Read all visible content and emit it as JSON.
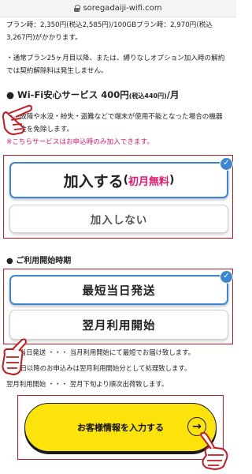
{
  "browser": {
    "url": "soregadaiji-wifi.com"
  },
  "top_text": {
    "price_line": "プラン時：2,350円(税込2,585円)/100GBプラン時：2,970円(税込3,267円)がかかります。",
    "note_line": "・通常プラン25ヶ月目以降、または、縛りなしオプション加入時の解約では契約解除料は発生しません。"
  },
  "wifi_section": {
    "heading_prefix": "●",
    "heading_main": " Wi-Fi安心サービス 400円",
    "heading_small": "(税込440円)",
    "heading_suffix": "/月",
    "desc_line1": "自然故障や水没・紛失・盗難などで端末が使用不能となった場合の機器",
    "desc_line2": "損害金を免除します。",
    "desc_pink": "※こちらサービスはお申込時のみ加入できます。",
    "option_join_main": "加入する",
    "option_join_open": "(",
    "option_join_pink": "初月無料",
    "option_join_close": ")",
    "option_nojoin": "加入しない",
    "check_glyph": "✓"
  },
  "start_section": {
    "heading": "● ご利用開始時期",
    "option_fast": "最短当日発送",
    "option_nextmonth": "翌月利用開始",
    "check_glyph": "✓",
    "line1": "最短当日発送 ・・・ 当月利用開始にて最短でお届け致します。",
    "line2": "※26日以降のお申込みは翌月利用開始分として処理致します。",
    "line3": "翌月利用開始 ・・・ 翌月下旬より順次出荷致します。"
  },
  "cta": {
    "label": "お客様情報を入力する",
    "arrow": "→"
  },
  "colors": {
    "accent_blue": "#3b86d6",
    "highlight_red": "#c41a1f",
    "pink": "#e6176e",
    "cta_yellow": "#fbe30b"
  },
  "icons": [
    "lock-icon",
    "check-icon",
    "pointing-hand-icon",
    "arrow-right-icon"
  ]
}
